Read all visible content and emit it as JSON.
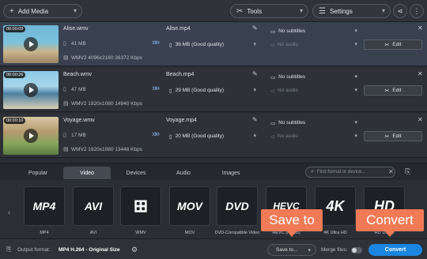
{
  "toolbar": {
    "add_media": "Add Media",
    "tools": "Tools",
    "settings": "Settings"
  },
  "files": [
    {
      "duration": "00:00:09",
      "name": "Alise.wmv",
      "size": "41 MB",
      "info": "WMV2 4096x2160 36372 Kbps",
      "output_name": "Alise.mp4",
      "output_size": "36 MB (Good quality)",
      "subtitles": "No subtitles",
      "audio": "No audio",
      "edit": "Edit",
      "selected": true
    },
    {
      "duration": "00:00:26",
      "name": "Beach.wmv",
      "size": "47 MB",
      "info": "WMV2 1920x1080 14940 Kbps",
      "output_name": "Beach.mp4",
      "output_size": "29 MB (Good quality)",
      "subtitles": "No subtitles",
      "audio": "No audio",
      "edit": "Edit",
      "selected": false
    },
    {
      "duration": "00:00:10",
      "name": "Voyage.wmv",
      "size": "17 MB",
      "info": "WMV2 1920x1080 13448 Kbps",
      "output_name": "Voyage.mp4",
      "output_size": "20 MB (Good quality)",
      "subtitles": "No subtitles",
      "audio": "No audio",
      "edit": "Edit",
      "selected": false
    }
  ],
  "tabs": [
    "Popular",
    "Video",
    "Devices",
    "Audio",
    "Images"
  ],
  "active_tab": "Video",
  "search_placeholder": "Find format or device...",
  "formats": [
    {
      "tile": "MP4",
      "label": "MP4"
    },
    {
      "tile": "AVI",
      "label": "AVI"
    },
    {
      "tile": "WMV",
      "label": "WMV"
    },
    {
      "tile": "MOV",
      "label": "MOV"
    },
    {
      "tile": "DVD",
      "label": "DVD-Compatible Video"
    },
    {
      "tile": "HEVC",
      "label": "HEVC (H.265)"
    },
    {
      "tile": "4K",
      "label": "4K Ultra HD"
    },
    {
      "tile": "HD",
      "label": "HD 1080p"
    }
  ],
  "bottom": {
    "output_format_label": "Output format:",
    "output_format_value": "MP4 H.264 - Original Size",
    "save_to": "Save to...",
    "merge_files": "Merge files:",
    "convert": "Convert"
  },
  "callouts": {
    "save_to": "Save to",
    "convert": "Convert"
  },
  "colors": {
    "accent": "#1a86e0",
    "callout": "#ef7a55",
    "selected_row": "#394150"
  }
}
